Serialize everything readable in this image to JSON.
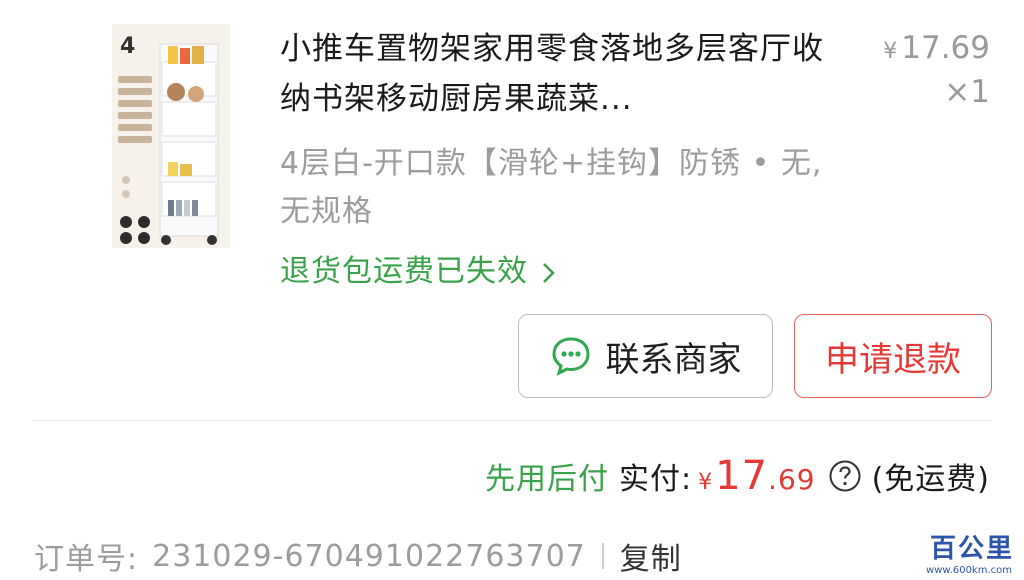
{
  "product": {
    "title": "小推车置物架家用零食落地多层客厅收纳书架移动厨房果蔬菜...",
    "price_symbol": "¥",
    "price": "17.69",
    "quantity": "×1",
    "spec": "4层白-开口款【滑轮+挂钩】防锈 • 无,无规格",
    "return_shipping": "退货包运费已失效",
    "thumbnail_icon": "shelf-cart-image",
    "thumbnail_number": "4"
  },
  "actions": {
    "contact_label": "联系商家",
    "contact_icon": "chat-bubble-icon",
    "refund_label": "申请退款"
  },
  "payment": {
    "pay_later": "先用后付",
    "actual_label": "实付:",
    "symbol": "¥",
    "amount_int": "17",
    "amount_dec": ".69",
    "help_icon": "question-circle-icon",
    "shipping_note": "(免运费)"
  },
  "order": {
    "label": "订单号:",
    "number": "231029-670491022763707",
    "copy_label": "复制"
  },
  "watermark": {
    "brand": "百公里",
    "url": "www.600km.com"
  },
  "colors": {
    "accent_red": "#e53935",
    "accent_green": "#3aa24a",
    "muted_gray": "#9c9c9c"
  }
}
